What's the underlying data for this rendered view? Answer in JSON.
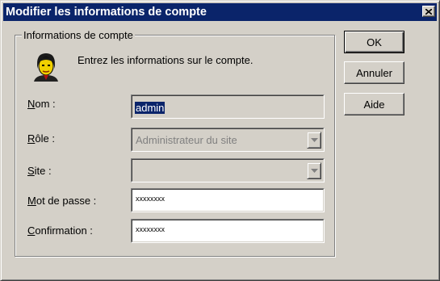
{
  "window": {
    "title": "Modifier les informations de compte"
  },
  "group": {
    "legend": "Informations de compte"
  },
  "intro_text": "Entrez les informations sur le compte.",
  "fields": {
    "nom": {
      "label_mnemonic": "N",
      "label_rest": "om :",
      "value": "admin"
    },
    "role": {
      "label_mnemonic": "R",
      "label_rest": "ôle :",
      "value": "Administrateur du site"
    },
    "site": {
      "label_mnemonic": "S",
      "label_rest": "ite :",
      "value": ""
    },
    "password": {
      "label_mnemonic": "M",
      "label_rest": "ot de passe :",
      "value": "xxxxxxxx"
    },
    "confirm": {
      "label_mnemonic": "C",
      "label_rest": "onfirmation :",
      "value": "xxxxxxxx"
    }
  },
  "buttons": {
    "ok": "OK",
    "cancel": "Annuler",
    "help": "Aide"
  },
  "icons": {
    "avatar": "user-face-icon",
    "close": "close-icon",
    "dropdown": "chevron-down-icon"
  },
  "colors": {
    "titlebar": "#0a246a",
    "face": "#d4d0c8",
    "selection": "#0a246a"
  }
}
